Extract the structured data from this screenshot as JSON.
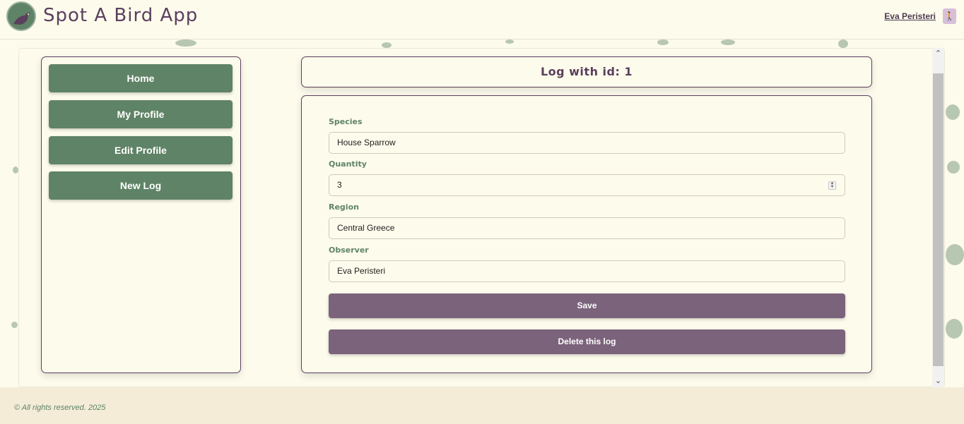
{
  "header": {
    "app_title": "Spot A Bird App",
    "user_name": "Eva Peristeri",
    "logo_icon": "bird-icon",
    "user_icon": "person-icon"
  },
  "sidebar": {
    "items": [
      {
        "label": "Home"
      },
      {
        "label": "My Profile"
      },
      {
        "label": "Edit Profile"
      },
      {
        "label": "New Log"
      }
    ]
  },
  "main": {
    "title": "Log with id: 1",
    "form": {
      "species_label": "Species",
      "species_value": "House Sparrow",
      "quantity_label": "Quantity",
      "quantity_value": "3",
      "region_label": "Region",
      "region_value": "Central Greece",
      "observer_label": "Observer",
      "observer_value": "Eva Peristeri",
      "save_label": "Save",
      "delete_label": "Delete this log"
    }
  },
  "footer": {
    "text": "© All rights reserved. 2025"
  },
  "colors": {
    "primary_green": "#5f8366",
    "primary_purple": "#7b637b",
    "title_purple": "#5b3f5e",
    "background": "#fdfbec",
    "footer_background": "#f4ecd7"
  }
}
